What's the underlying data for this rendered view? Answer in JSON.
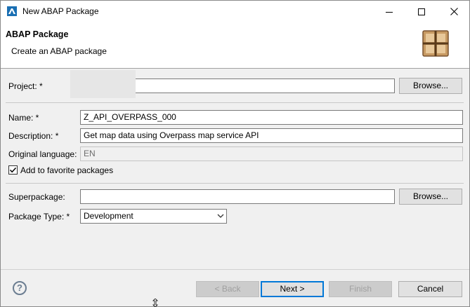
{
  "window": {
    "title": "New ABAP Package",
    "icon": "eclipse-abap-icon"
  },
  "header": {
    "title": "ABAP Package",
    "subtitle": "Create an ABAP package",
    "logo_icon": "package-icon"
  },
  "form": {
    "project": {
      "label": "Project: *",
      "value": "",
      "browse": "Browse..."
    },
    "name": {
      "label": "Name: *",
      "value": "Z_API_OVERPASS_000"
    },
    "description": {
      "label": "Description: *",
      "value": "Get map data using Overpass map service API"
    },
    "original_language": {
      "label": "Original language:",
      "value": "EN"
    },
    "favorite": {
      "label": "Add to favorite packages",
      "checked": true
    },
    "superpackage": {
      "label": "Superpackage:",
      "value": "",
      "browse": "Browse..."
    },
    "package_type": {
      "label": "Package Type: *",
      "value": "Development"
    }
  },
  "footer": {
    "help_icon": "help-icon",
    "back": "< Back",
    "next": "Next >",
    "finish": "Finish",
    "cancel": "Cancel"
  },
  "colors": {
    "focus_border": "#0078d7",
    "background": "#f0f0f0"
  }
}
